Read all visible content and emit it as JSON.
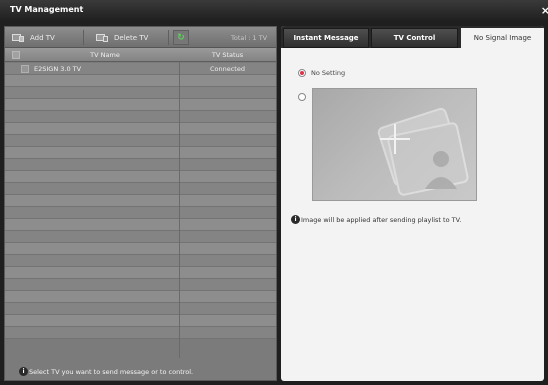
{
  "window": {
    "title": "TV Management",
    "close_glyph": "×"
  },
  "toolbar": {
    "add_tv_label": "Add TV",
    "delete_tv_label": "Delete TV",
    "refresh_glyph": "↻",
    "total_text": "Total : 1 TV"
  },
  "tv_table": {
    "columns": {
      "name": "TV Name",
      "status": "TV Status"
    },
    "rows": [
      {
        "name": "E2SIGN 3.0 TV",
        "status": "Connected",
        "checked": false
      }
    ]
  },
  "left_footer": {
    "info_glyph": "i",
    "text": "Select TV you want to send message or to control."
  },
  "tabs": {
    "instant_message": "Instant Message",
    "tv_control": "TV Control",
    "no_signal_image": "No Signal Image",
    "active": "no_signal_image"
  },
  "no_signal": {
    "option_none_label": "No Setting",
    "option_none_checked": true,
    "option_image_checked": false,
    "hint_glyph": "i",
    "hint_text": "Image will be applied after sending playlist to TV."
  },
  "colors": {
    "radio_selected": "#d9364a",
    "panel_dark": "#1f1f1f",
    "list_bg": "#848484",
    "refresh_green": "#5fd15f"
  },
  "icons": [
    "close-icon",
    "add-tv-icon",
    "delete-tv-icon",
    "refresh-icon",
    "info-icon",
    "add-image-icon",
    "photo-placeholder-icon"
  ]
}
